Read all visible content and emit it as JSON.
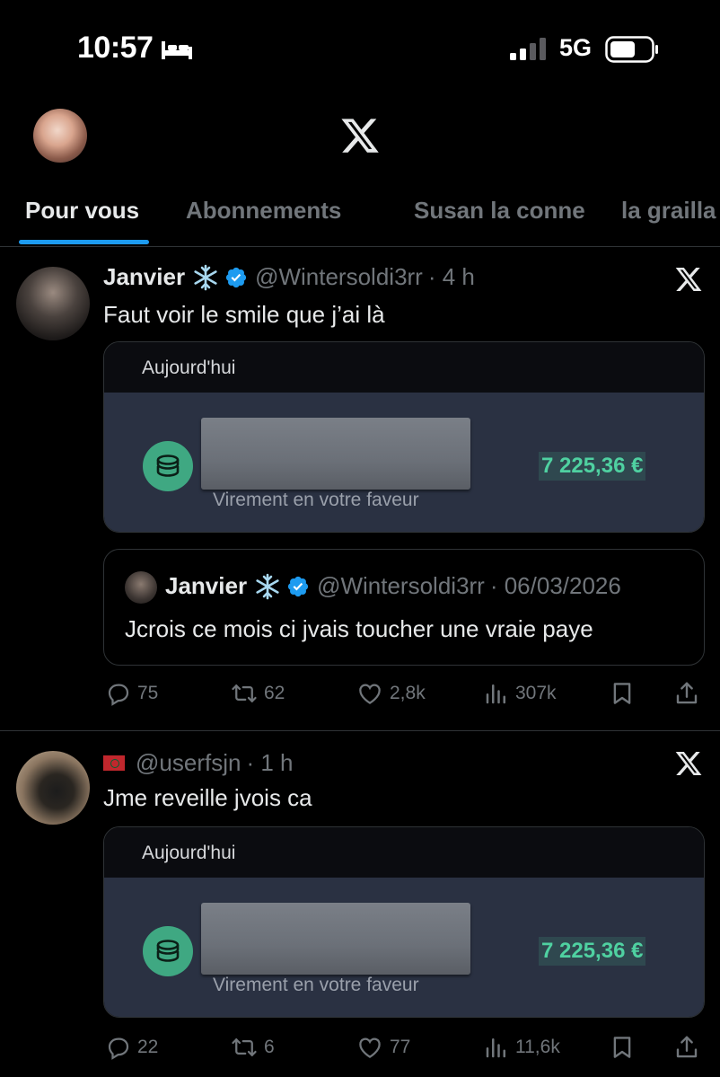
{
  "status_bar": {
    "time": "10:57",
    "network": "5G"
  },
  "tabs": [
    {
      "label": "Pour vous",
      "active": true
    },
    {
      "label": "Abonnements",
      "active": false
    },
    {
      "label": "Susan la conne",
      "active": false
    },
    {
      "label": "la grailla",
      "active": false
    }
  ],
  "tweets": [
    {
      "name": "Janvier",
      "handle": "@Wintersoldi3rr",
      "time": "· 4 h",
      "text": "Faut voir le smile que j’ai là",
      "card": {
        "date": "Aujourd'hui",
        "subtitle": "Virement en votre faveur",
        "amount": "7 225,36 €"
      },
      "quote": {
        "name": "Janvier",
        "handle": "@Wintersoldi3rr",
        "date": "· 06/03/2026",
        "text": "Jcrois ce mois ci jvais toucher une vraie paye"
      },
      "stats": {
        "replies": "75",
        "reposts": "62",
        "likes": "2,8k",
        "views": "307k"
      }
    },
    {
      "handle": "@userfsjn",
      "time": "· 1 h",
      "text": "Jme reveille jvois ca",
      "card": {
        "date": "Aujourd'hui",
        "subtitle": "Virement en votre faveur",
        "amount": "7 225,36 €"
      },
      "stats": {
        "replies": "22",
        "reposts": "6",
        "likes": "77",
        "views": "11,6k"
      }
    }
  ],
  "colors": {
    "accent": "#1d9bf0",
    "money": "#4fd1a1",
    "card_bg": "#2a3142",
    "coin": "#3fa882"
  }
}
